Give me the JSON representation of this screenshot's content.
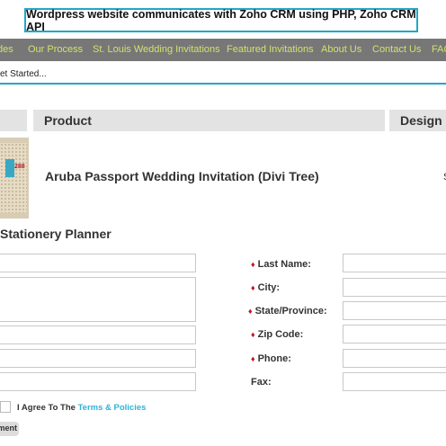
{
  "banner": {
    "title": "Wordpress website communicates with Zoho CRM using PHP, Zoho CRM API"
  },
  "nav": {
    "items": [
      "des",
      "Our Process",
      "St. Louis Wedding Invitations",
      "Featured Invitations",
      "About Us",
      "Contact Us",
      "FAQ"
    ]
  },
  "breadcrumb": {
    "text": "et Started..."
  },
  "table": {
    "headers": [
      "Product",
      "Design F"
    ],
    "row": {
      "product": "Aruba Passport Wedding Invitation (Divi Tree)",
      "thumb_number": "288",
      "design": "S"
    }
  },
  "form": {
    "section_title": "Stationery Planner",
    "labels": {
      "last_name": "Last Name:",
      "city": "City:",
      "state": "State/Province:",
      "zip": "Zip Code:",
      "phone": "Phone:",
      "fax": "Fax:"
    },
    "required_marker": "♦",
    "agree_prefix": "I Agree To The ",
    "agree_link": "Terms & Policies",
    "submit_label": "ment"
  },
  "colors": {
    "accent": "#22a6c9",
    "nav_bg": "#777777",
    "nav_text": "#cfe36a",
    "required": "#c8102e"
  }
}
